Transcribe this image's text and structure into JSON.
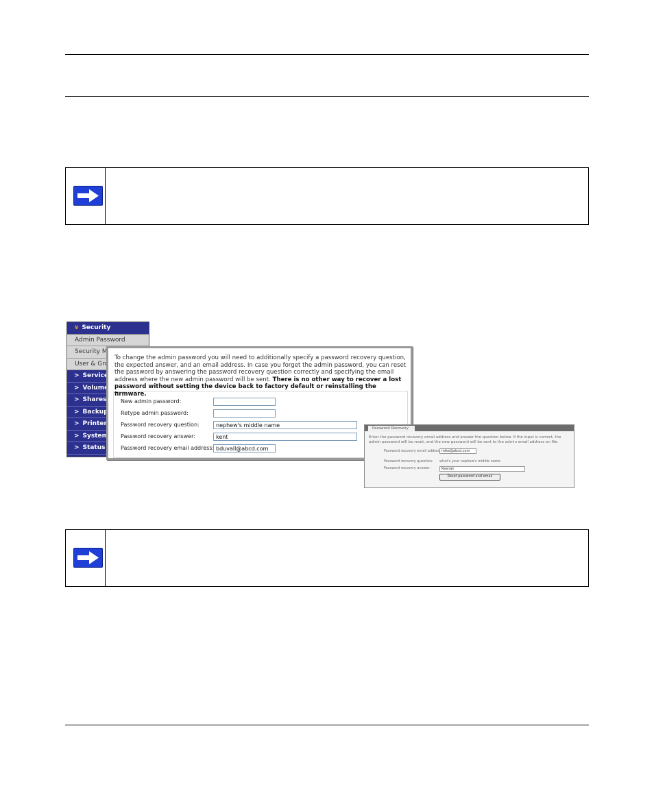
{
  "header_text": "",
  "notes": [
    {
      "icon": "arrow-right-icon",
      "text": ""
    },
    {
      "icon": "arrow-right-icon",
      "text": ""
    }
  ],
  "sidebar": {
    "header": {
      "label": "Security",
      "icon": "chevron-down-icon"
    },
    "sub_items": [
      "Admin Password",
      "Security Mode",
      "User & Groups"
    ],
    "groups": [
      "Services",
      "Volumes",
      "Shares",
      "Backup",
      "Printers",
      "System",
      "Status"
    ]
  },
  "admin_panel": {
    "intro": "To change the admin password you will need to additionally specify a password recovery question, the expected answer, and an email address. In case you forget the admin password, you can reset the password by answering the password recovery question correctly and specifying the email address where the new admin password will be sent.",
    "intro_bold": "There is no other way to recover a lost password without setting the device back to factory default or reinstalling the firmware.",
    "fields": [
      {
        "label": "New admin password:",
        "value": ""
      },
      {
        "label": "Retype admin password:",
        "value": ""
      },
      {
        "label": "Password recovery question:",
        "value": "nephew's middle name"
      },
      {
        "label": "Password recovery answer:",
        "value": "kent"
      },
      {
        "label": "Password recovery email address:",
        "value": "bduvall@abcd.com"
      }
    ]
  },
  "recovery_panel": {
    "tab": "Password Recovery",
    "description": "Enter the password recovery email address and answer the question below. If the input is correct, the admin password will be reset, and the new password will be sent to the admin email address on file.",
    "email_label": "Password recovery email address:",
    "email_value": "mike@abcd.com",
    "question_label": "Password recovery question:",
    "question_value": "what's your nephew's middle name",
    "answer_label": "Password recovery answer:",
    "answer_value": "Keenan",
    "button": "Reset password and email"
  }
}
